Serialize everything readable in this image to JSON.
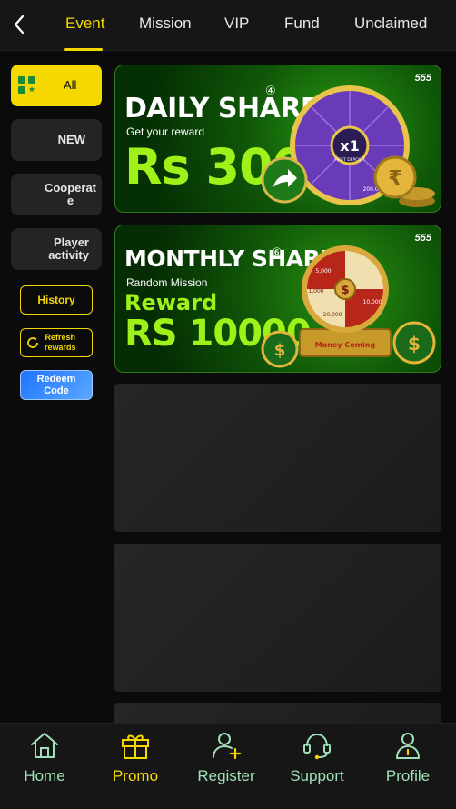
{
  "header": {
    "tabs": [
      {
        "label": "Event"
      },
      {
        "label": "Mission"
      },
      {
        "label": "VIP"
      },
      {
        "label": "Fund"
      },
      {
        "label": "Unclaimed"
      }
    ]
  },
  "sidebar": {
    "items": [
      {
        "label": "All"
      },
      {
        "label": "NEW"
      },
      {
        "label": "Cooperat\ne"
      },
      {
        "label": "Player\nactivity"
      }
    ],
    "history_label": "History",
    "refresh_label": "Refresh\nrewards",
    "redeem_label": "Redeem\nCode"
  },
  "banners": [
    {
      "title": "DAILY SHARE",
      "badge": "④",
      "subtitle": "Get your reward",
      "reward": "Rs 300",
      "brand": "555",
      "wheel_center": "x1",
      "wheel_center_sub": "FIRST DEPOSIT",
      "wheel_value": "200.00"
    },
    {
      "title": "MONTHLY SHARING",
      "badge": "⑥",
      "subtitle": "Random Mission",
      "reward_label": "Reward",
      "reward": "RS 10000",
      "brand": "555",
      "wheel_values": [
        "5,000",
        "1,000",
        "10,000",
        "20,000"
      ],
      "sign": "Money Coming"
    }
  ],
  "bottom_nav": {
    "items": [
      {
        "label": "Home"
      },
      {
        "label": "Promo"
      },
      {
        "label": "Register"
      },
      {
        "label": "Support"
      },
      {
        "label": "Profile"
      }
    ]
  },
  "colors": {
    "accent": "#f5d800",
    "nav_text": "#9fe0b8",
    "banner_green": "#0f5608",
    "reward_green": "#9ef21a"
  }
}
